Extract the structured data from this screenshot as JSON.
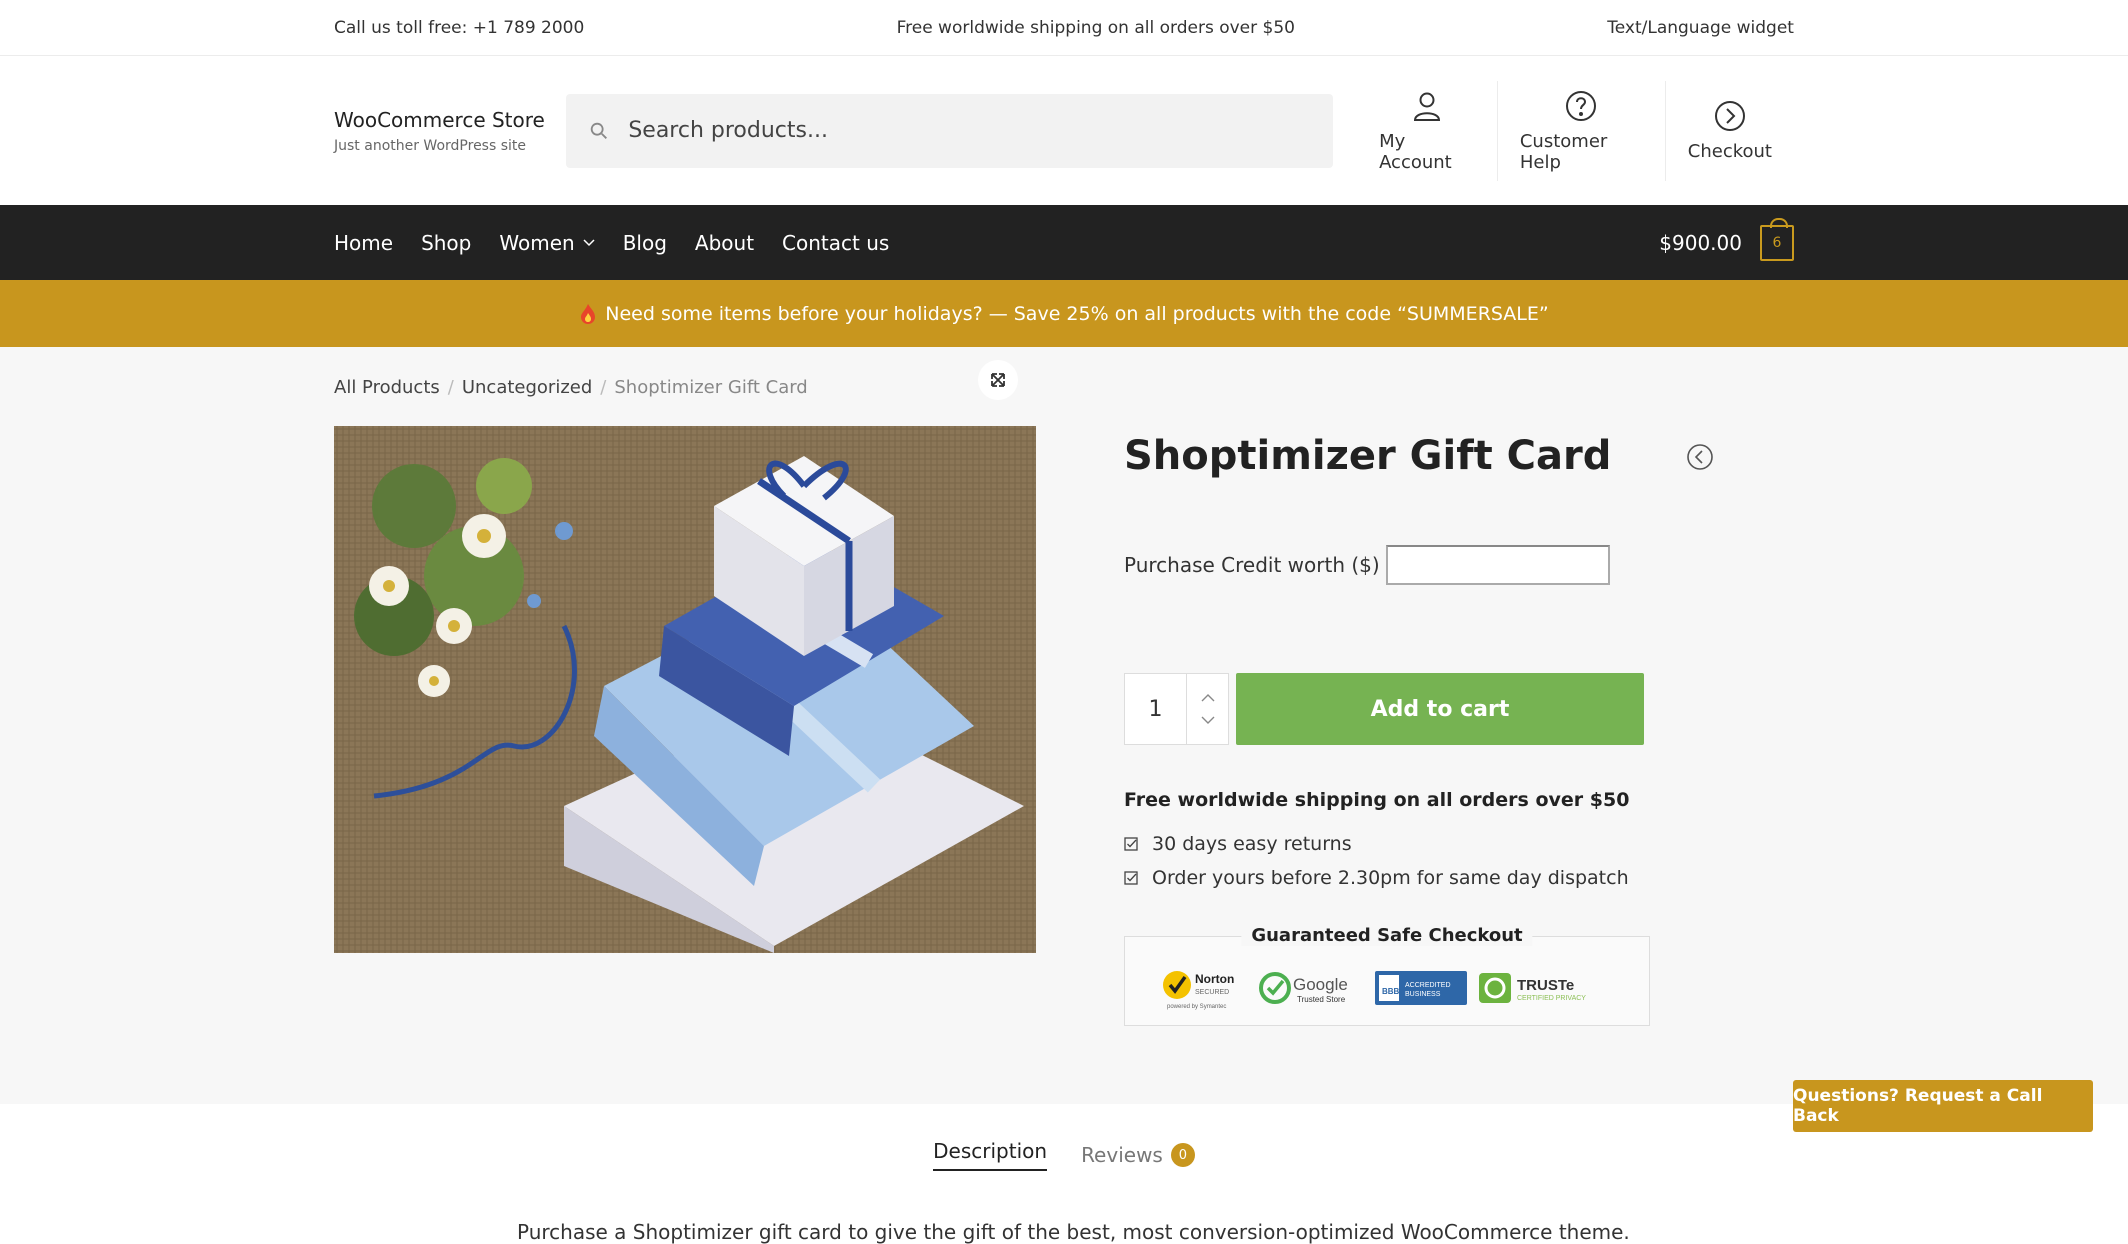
{
  "topbar": {
    "phone": "Call us toll free: +1 789 2000",
    "shipping": "Free worldwide shipping on all orders over $50",
    "widget": "Text/Language widget"
  },
  "header": {
    "brand_name": "WooCommerce Store",
    "brand_tagline": "Just another WordPress site",
    "search_placeholder": "Search products...",
    "links": [
      {
        "label": "My Account",
        "icon": "user-icon"
      },
      {
        "label": "Customer Help",
        "icon": "help-icon"
      },
      {
        "label": "Checkout",
        "icon": "arrow-right-circle-icon"
      }
    ]
  },
  "nav": {
    "items": [
      "Home",
      "Shop",
      "Women",
      "Blog",
      "About",
      "Contact us"
    ],
    "cart_total": "$900.00",
    "cart_count": "6"
  },
  "promo": {
    "text": "Need some items before your holidays? — Save 25% on all products with the code “SUMMERSALE”"
  },
  "breadcrumb": {
    "items": [
      "All Products",
      "Uncategorized"
    ],
    "current": "Shoptimizer Gift Card"
  },
  "product": {
    "title": "Shoptimizer Gift Card",
    "credit_label": "Purchase Credit worth ($)",
    "credit_value": "",
    "quantity": "1",
    "add_to_cart": "Add to cart",
    "shipping_title": "Free worldwide shipping on all orders over $50",
    "features": [
      "30 days easy returns",
      "Order yours before 2.30pm for same day dispatch"
    ],
    "safe_checkout_title": "Guaranteed Safe Checkout",
    "badges": [
      "Norton Secured",
      "Google Trusted Store",
      "BBB Accredited Business",
      "TRUSTe Certified Privacy"
    ]
  },
  "callback": "Questions? Request a Call Back",
  "tabs": {
    "description": "Description",
    "reviews": "Reviews",
    "reviews_count": "0"
  },
  "description_text": "Purchase a Shoptimizer gift card to give the gift of the best, most conversion-optimized WooCommerce theme.",
  "colors": {
    "accent": "#c8961e",
    "nav_bg": "#222222",
    "add_to_cart": "#76b352"
  }
}
